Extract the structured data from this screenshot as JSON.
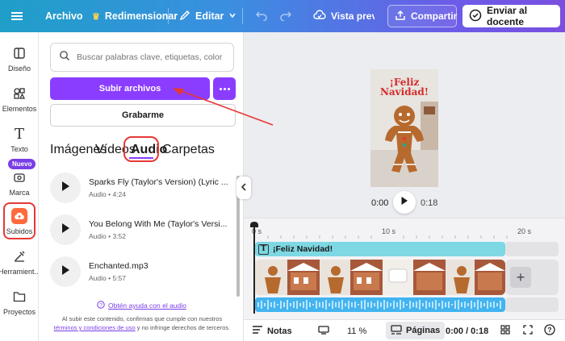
{
  "topbar": {
    "menu_file": "Archivo",
    "resize": "Redimensionar",
    "edit": "Editar",
    "preview": "Vista previa",
    "share": "Compartir",
    "send_teacher": "Enviar al docente"
  },
  "rail": {
    "items": [
      {
        "label": "Diseño",
        "icon": "layout-icon"
      },
      {
        "label": "Elementos",
        "icon": "shapes-icon"
      },
      {
        "label": "Texto",
        "icon": "text-icon"
      },
      {
        "label": "Marca",
        "icon": "brand-icon"
      },
      {
        "label": "Subidos",
        "icon": "cloud-upload-icon"
      },
      {
        "label": "Herramient...",
        "icon": "tools-icon"
      },
      {
        "label": "Proyectos",
        "icon": "folder-icon"
      }
    ],
    "new_badge": "Nuevo",
    "accent": "#ff6a3d"
  },
  "panel": {
    "search_placeholder": "Buscar palabras clave, etiquetas, color",
    "upload_button": "Subir archivos",
    "record_button": "Grabarme",
    "tabs": [
      "Imágenes",
      "Vídeos",
      "Audio",
      "Carpetas"
    ],
    "active_tab": "Audio",
    "audio_items": [
      {
        "title": "Sparks Fly (Taylor's Version) (Lyric ...",
        "meta": "Audio • 4:24"
      },
      {
        "title": "You Belong With Me (Taylor's Versi...",
        "meta": "Audio • 3:52"
      },
      {
        "title": "Enchanted.mp3",
        "meta": "Audio • 5:57"
      }
    ],
    "help_link": "Obtén ayuda con el audio",
    "legal_prefix": "Al subir este contenido, confirmas que cumple con nuestros",
    "legal_link": "términos y condiciones de uso",
    "legal_suffix": "y no infringe derechos de terceros."
  },
  "canvas": {
    "page_title_line1": "¡Feliz",
    "page_title_line2": "Navidad!",
    "time_current": "0:00",
    "time_total": "0:18"
  },
  "timeline": {
    "ruler": [
      "0 s",
      "10 s",
      "20 s"
    ],
    "text_clip": "¡Feliz Navidad!",
    "colors": {
      "text_clip": "#7ed8e3",
      "audio_clip": "#42b4f0"
    }
  },
  "bottombar": {
    "notes": "Notas",
    "zoom": "11 %",
    "pages": "Páginas",
    "time": "0:00 / 0:18"
  }
}
